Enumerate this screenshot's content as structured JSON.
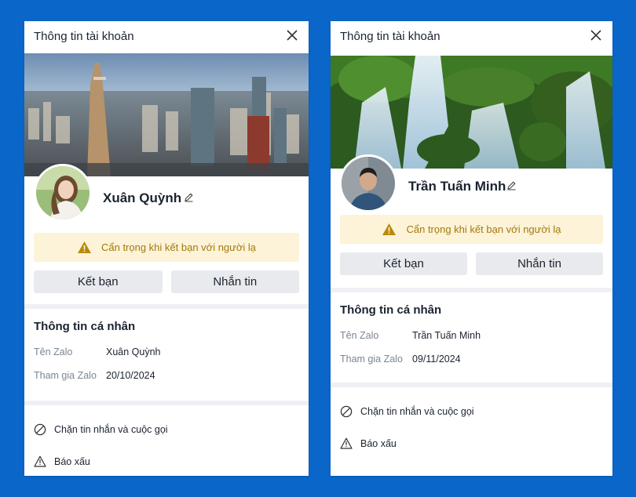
{
  "cards": [
    {
      "header_title": "Thông tin tài khoản",
      "name": "Xuân Quỳnh",
      "warning": "Cẩn trọng khi kết bạn với người lạ",
      "add_friend_label": "Kết bạn",
      "message_label": "Nhắn tin",
      "section_title": "Thông tin cá nhân",
      "fields": [
        {
          "label": "Tên Zalo",
          "value": "Xuân Quỳnh"
        },
        {
          "label": "Tham gia Zalo",
          "value": "20/10/2024"
        }
      ],
      "block_label": "Chặn tin nhắn và cuộc gọi",
      "report_label": "Báo xấu"
    },
    {
      "header_title": "Thông tin tài khoản",
      "name": "Trần Tuấn Minh",
      "warning": "Cẩn trọng khi kết bạn với người lạ",
      "add_friend_label": "Kết bạn",
      "message_label": "Nhắn tin",
      "section_title": "Thông tin cá nhân",
      "fields": [
        {
          "label": "Tên Zalo",
          "value": "Trần Tuấn Minh"
        },
        {
          "label": "Tham gia Zalo",
          "value": "09/11/2024"
        }
      ],
      "block_label": "Chặn tin nhắn và cuộc gọi",
      "report_label": "Báo xấu"
    }
  ],
  "colors": {
    "background": "#0a66c8",
    "warning_bg": "#fdf3d8",
    "warning_text": "#a2790b",
    "button_bg": "#e8eaed"
  },
  "icons": [
    "close-icon",
    "pencil-icon",
    "warning-icon",
    "block-icon",
    "report-icon"
  ]
}
